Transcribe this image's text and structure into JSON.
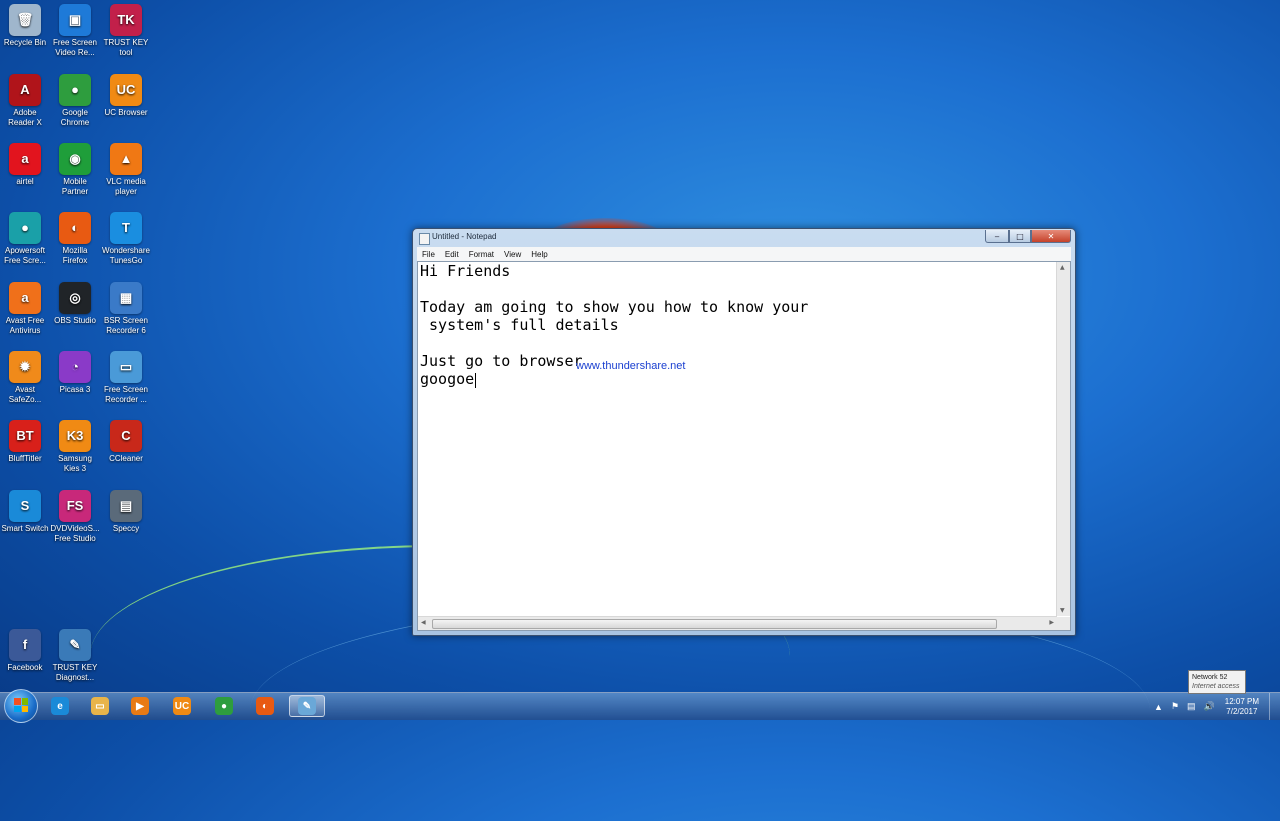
{
  "desktop": {
    "icons": [
      {
        "label": "Recycle Bin",
        "glyph": "🗑",
        "color": "#9fb6cc"
      },
      {
        "label": "Free Screen Video Re...",
        "glyph": "▣",
        "color": "#1e7ad8"
      },
      {
        "label": "TRUST KEY tool",
        "glyph": "TK",
        "color": "#c2204a"
      },
      {
        "label": "Adobe Reader X",
        "glyph": "A",
        "color": "#b0141a"
      },
      {
        "label": "Google Chrome",
        "glyph": "●",
        "color": "#2e9d3e"
      },
      {
        "label": "UC Browser",
        "glyph": "UC",
        "color": "#f08a14"
      },
      {
        "label": "airtel",
        "glyph": "a",
        "color": "#e2141e"
      },
      {
        "label": "Mobile Partner",
        "glyph": "◉",
        "color": "#1f9e3a"
      },
      {
        "label": "VLC media player",
        "glyph": "▲",
        "color": "#f07814"
      },
      {
        "label": "Apowersoft Free Scre...",
        "glyph": "●",
        "color": "#1aa0a8"
      },
      {
        "label": "Mozilla Firefox",
        "glyph": "◐",
        "color": "#e85a12"
      },
      {
        "label": "Wondershare TunesGo",
        "glyph": "T",
        "color": "#1a8ee0"
      },
      {
        "label": "Avast Free Antivirus",
        "glyph": "a",
        "color": "#f0701a"
      },
      {
        "label": "OBS Studio",
        "glyph": "◎",
        "color": "#202428"
      },
      {
        "label": "BSR Screen Recorder 6",
        "glyph": "▦",
        "color": "#3a7ac8"
      },
      {
        "label": "Avast SafeZo...",
        "glyph": "✹",
        "color": "#f08a1a"
      },
      {
        "label": "Picasa 3",
        "glyph": "◔",
        "color": "#8a3ac8"
      },
      {
        "label": "Free Screen Recorder ...",
        "glyph": "▭",
        "color": "#4a9ad8"
      },
      {
        "label": "BluffTitler",
        "glyph": "BT",
        "color": "#d8201a"
      },
      {
        "label": "Samsung Kies 3",
        "glyph": "K3",
        "color": "#f08a14"
      },
      {
        "label": "CCleaner",
        "glyph": "C",
        "color": "#c8281a"
      },
      {
        "label": "Smart Switch",
        "glyph": "S",
        "color": "#1a8ad8"
      },
      {
        "label": "DVDVideoS... Free Studio",
        "glyph": "FS",
        "color": "#c8287a"
      },
      {
        "label": "Speccy",
        "glyph": "▤",
        "color": "#5a6a7a"
      },
      {
        "label": "Facebook",
        "glyph": "f",
        "color": "#3b5998"
      },
      {
        "label": "TRUST KEY Diagnost...",
        "glyph": "✎",
        "color": "#3a7ab8"
      }
    ]
  },
  "notepad": {
    "title": "Untitled - Notepad",
    "window_buttons": {
      "minimize": "‒",
      "maximize": "□",
      "close": "✕"
    },
    "menu": [
      "File",
      "Edit",
      "Format",
      "View",
      "Help"
    ],
    "content": "Hi Friends\n\nToday am going to show you how to know your\n system's full details\n\nJust go to browser\ngoogoe",
    "watermark": "www.thundershare.net",
    "scroll_glyphs": {
      "up": "▲",
      "down": "▼",
      "left": "◀",
      "right": "▶",
      "grip": "≡"
    }
  },
  "taskbar": {
    "apps": [
      {
        "name": "Internet Explorer",
        "glyph": "e",
        "color": "#1a8ad8"
      },
      {
        "name": "Windows Explorer",
        "glyph": "▭",
        "color": "#e8b44a"
      },
      {
        "name": "Windows Media Player",
        "glyph": "▶",
        "color": "#e87a14"
      },
      {
        "name": "UC Browser",
        "glyph": "UC",
        "color": "#f08a14"
      },
      {
        "name": "Google Chrome",
        "glyph": "●",
        "color": "#2e9d3e"
      },
      {
        "name": "Mozilla Firefox",
        "glyph": "◐",
        "color": "#e85a12"
      },
      {
        "name": "Notepad",
        "glyph": "✎",
        "color": "#6aa8d8"
      }
    ],
    "tray_icons": {
      "expand": "▲",
      "flag": "⚑",
      "network": "▤",
      "volume": "🔊"
    },
    "clock_time": "12:07 PM",
    "clock_date": "7/2/2017"
  },
  "network_tooltip": {
    "title": "Network  52",
    "status": "Internet access"
  }
}
